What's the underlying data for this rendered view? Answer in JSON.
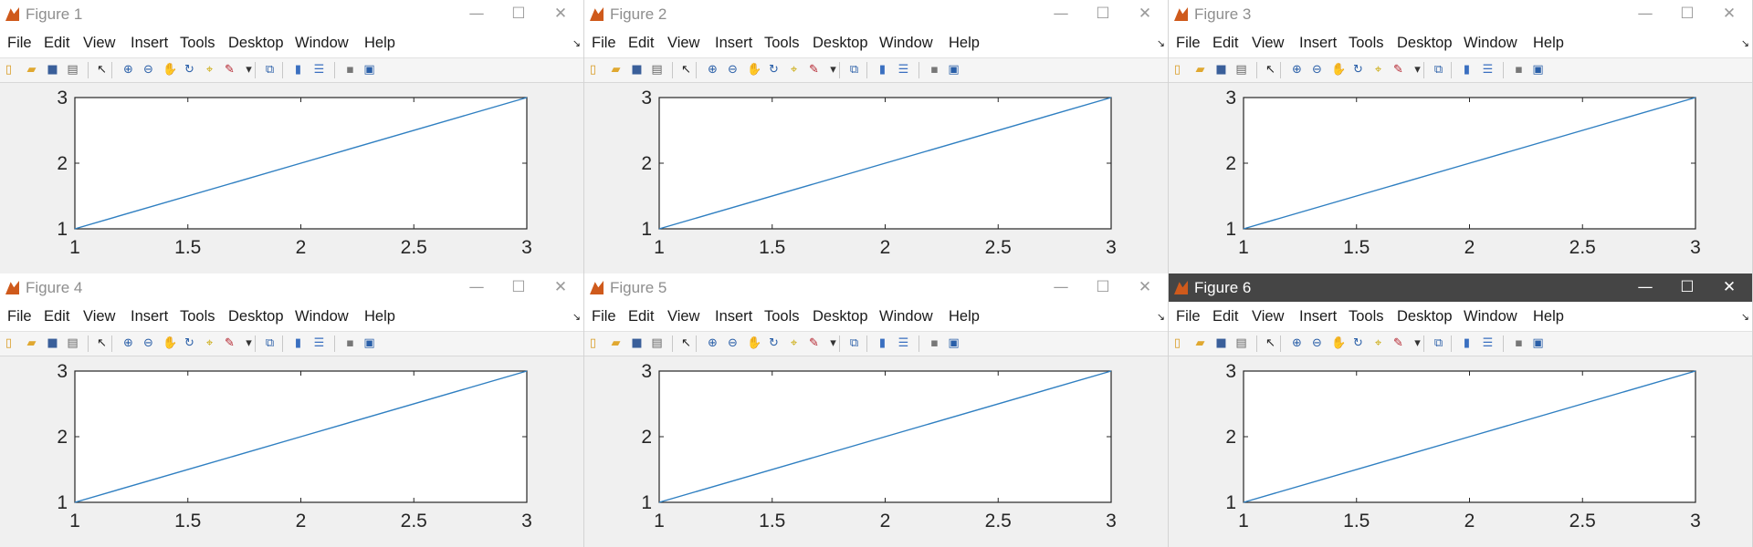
{
  "accent_active_titlebar": "#454545",
  "line_color": "#2f7fc1",
  "menu": [
    "File",
    "Edit",
    "View",
    "Insert",
    "Tools",
    "Desktop",
    "Window",
    "Help"
  ],
  "toolbar_icons": [
    "new-figure-icon",
    "open-file-icon",
    "save-icon",
    "print-icon",
    "select-pointer-icon",
    "zoom-in-icon",
    "zoom-out-icon",
    "pan-icon",
    "rotate-3d-icon",
    "data-cursor-icon",
    "brush-icon",
    "brush-dropdown-icon",
    "link-plot-icon",
    "colorbar-icon",
    "legend-icon",
    "hide-plot-tools-icon",
    "show-plot-tools-icon"
  ],
  "window_controls": {
    "minimize": "—",
    "maximize": "☐",
    "close": "✕"
  },
  "figures": [
    {
      "title": "Figure 1",
      "active": false
    },
    {
      "title": "Figure 2",
      "active": false
    },
    {
      "title": "Figure 3",
      "active": false
    },
    {
      "title": "Figure 4",
      "active": false
    },
    {
      "title": "Figure 5",
      "active": false
    },
    {
      "title": "Figure 6",
      "active": true
    }
  ],
  "chart_data": {
    "type": "line",
    "x": [
      1,
      2,
      3
    ],
    "y": [
      1,
      2,
      3
    ],
    "xlim": [
      1,
      3
    ],
    "ylim": [
      1,
      3
    ],
    "xticks": [
      "1",
      "1.5",
      "2",
      "2.5",
      "3"
    ],
    "yticks": [
      "1",
      "2",
      "3"
    ],
    "grid": false,
    "title": "",
    "xlabel": "",
    "ylabel": ""
  }
}
